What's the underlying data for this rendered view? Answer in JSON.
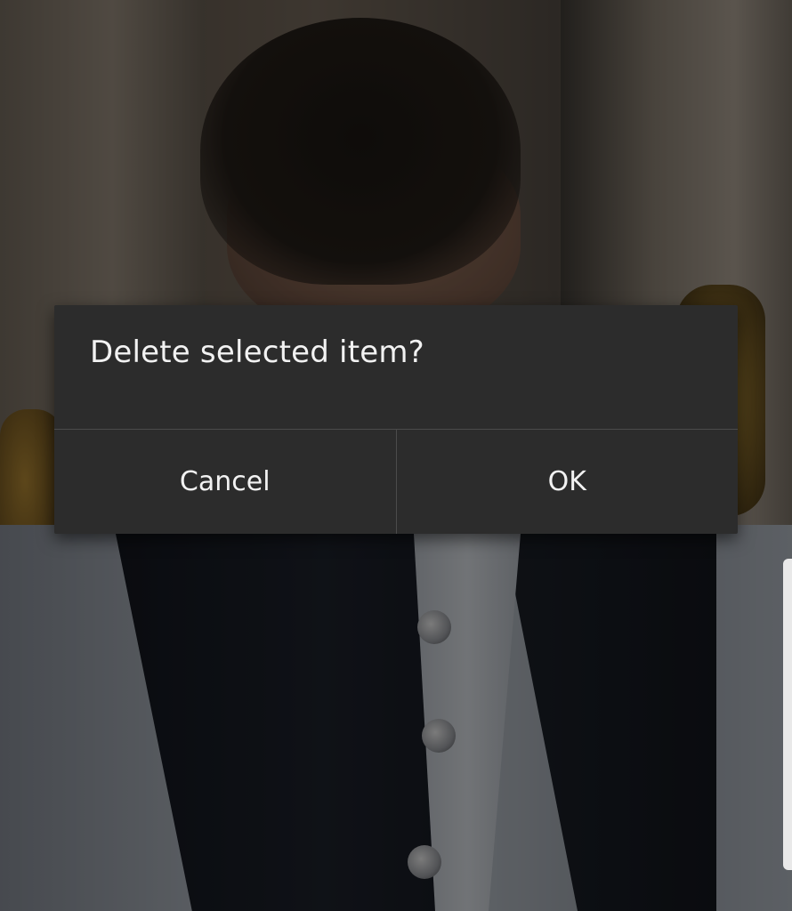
{
  "dialog": {
    "message": "Delete selected item?",
    "cancel_label": "Cancel",
    "ok_label": "OK"
  },
  "colors": {
    "dialog_background": "#2c2c2c",
    "dialog_text": "#f2f2f2",
    "divider": "#4b4b4b"
  }
}
